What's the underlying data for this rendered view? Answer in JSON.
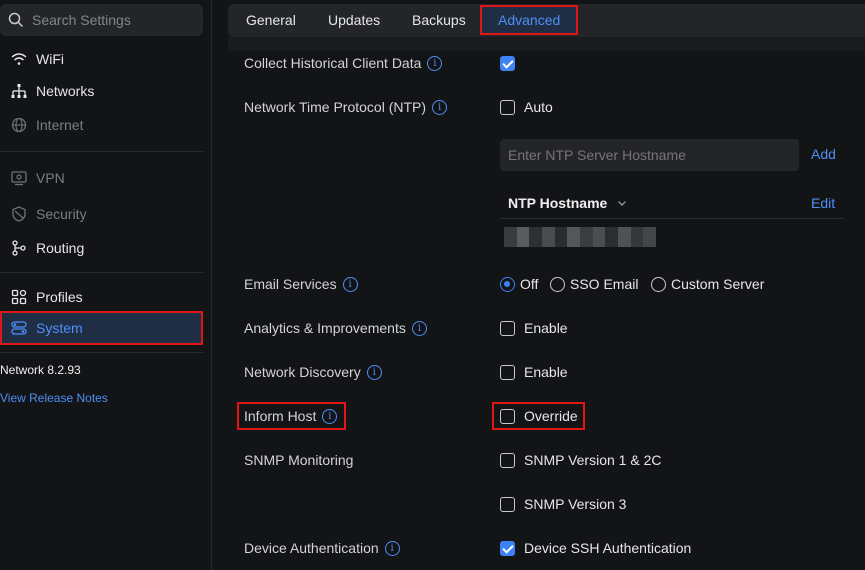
{
  "search": {
    "placeholder": "Search Settings"
  },
  "sidebar": {
    "items": [
      {
        "label": "WiFi",
        "icon": "wifi-icon"
      },
      {
        "label": "Networks",
        "icon": "network-tree-icon"
      },
      {
        "label": "Internet",
        "icon": "globe-icon"
      },
      {
        "label": "VPN",
        "icon": "vpn-icon"
      },
      {
        "label": "Security",
        "icon": "shield-icon"
      },
      {
        "label": "Routing",
        "icon": "routing-icon"
      },
      {
        "label": "Profiles",
        "icon": "profiles-icon"
      },
      {
        "label": "System",
        "icon": "system-toggle-icon",
        "active": true
      }
    ],
    "version": "Network 8.2.93",
    "release_notes": "View Release Notes"
  },
  "tabs": [
    {
      "label": "General"
    },
    {
      "label": "Updates"
    },
    {
      "label": "Backups"
    },
    {
      "label": "Advanced",
      "active": true
    }
  ],
  "settings": {
    "collect_historical": {
      "label": "Collect Historical Client Data",
      "checked": true
    },
    "ntp": {
      "label": "Network Time Protocol (NTP)",
      "auto_label": "Auto",
      "auto_checked": false,
      "input_placeholder": "Enter NTP Server Hostname",
      "add_label": "Add",
      "column_header": "NTP Hostname",
      "edit_label": "Edit"
    },
    "email": {
      "label": "Email Services",
      "options": [
        "Off",
        "SSO Email",
        "Custom Server"
      ],
      "selected": "Off"
    },
    "analytics": {
      "label": "Analytics & Improvements",
      "option": "Enable",
      "checked": false
    },
    "discovery": {
      "label": "Network Discovery",
      "option": "Enable",
      "checked": false
    },
    "inform_host": {
      "label": "Inform Host",
      "option": "Override",
      "checked": false
    },
    "snmp": {
      "label": "SNMP Monitoring",
      "v1_label": "SNMP Version 1 & 2C",
      "v3_label": "SNMP Version 3"
    },
    "device_auth": {
      "label": "Device Authentication",
      "option": "Device SSH Authentication",
      "checked": true
    }
  },
  "colors": {
    "accent": "#4f8ff7",
    "highlight": "#e01515",
    "background": "#131416"
  }
}
